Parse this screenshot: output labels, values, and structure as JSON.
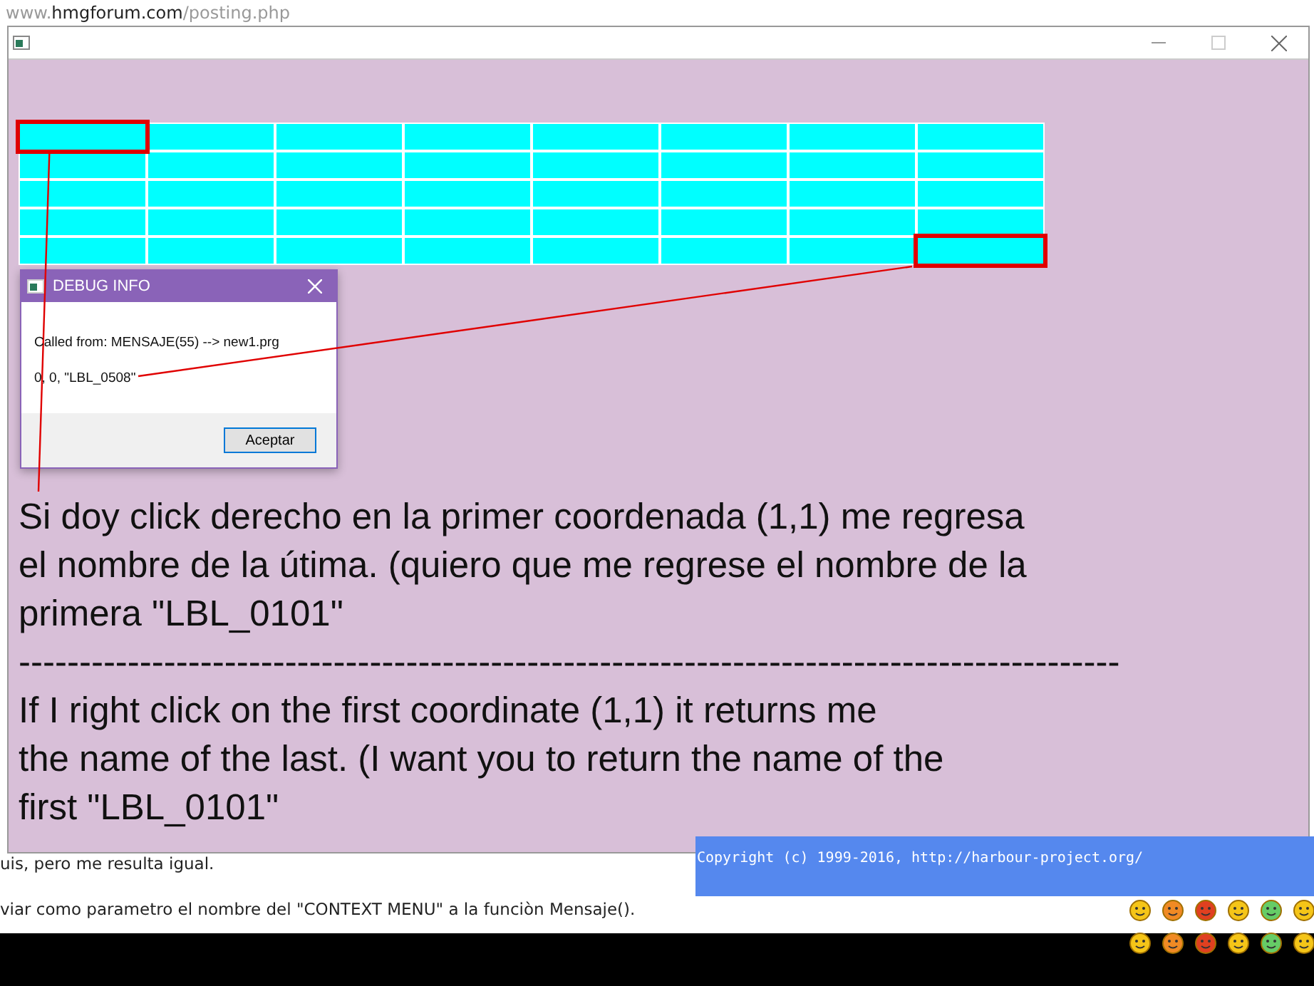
{
  "browser": {
    "url_prefix": "www.",
    "url_domain": "hmgforum.com",
    "url_path": "/posting.php"
  },
  "window": {
    "grid": {
      "rows": [
        {
          "cells": [
            {
              "highlighted": true
            },
            {
              "highlighted": false
            },
            {
              "highlighted": false
            },
            {
              "highlighted": false
            },
            {
              "highlighted": false
            },
            {
              "highlighted": false
            },
            {
              "highlighted": false
            },
            {
              "highlighted": false
            }
          ]
        },
        {
          "cells": [
            {
              "highlighted": false
            },
            {
              "highlighted": false
            },
            {
              "highlighted": false
            },
            {
              "highlighted": false
            },
            {
              "highlighted": false
            },
            {
              "highlighted": false
            },
            {
              "highlighted": false
            },
            {
              "highlighted": false
            }
          ]
        },
        {
          "cells": [
            {
              "highlighted": false
            },
            {
              "highlighted": false
            },
            {
              "highlighted": false
            },
            {
              "highlighted": false
            },
            {
              "highlighted": false
            },
            {
              "highlighted": false
            },
            {
              "highlighted": false
            },
            {
              "highlighted": false
            }
          ]
        },
        {
          "cells": [
            {
              "highlighted": false
            },
            {
              "highlighted": false
            },
            {
              "highlighted": false
            },
            {
              "highlighted": false
            },
            {
              "highlighted": false
            },
            {
              "highlighted": false
            },
            {
              "highlighted": false
            },
            {
              "highlighted": false
            }
          ]
        },
        {
          "cells": [
            {
              "highlighted": false
            },
            {
              "highlighted": false
            },
            {
              "highlighted": false
            },
            {
              "highlighted": false
            },
            {
              "highlighted": false
            },
            {
              "highlighted": false
            },
            {
              "highlighted": false
            },
            {
              "highlighted": true
            }
          ]
        }
      ]
    },
    "dialog": {
      "title": "DEBUG INFO",
      "lines": [
        "Called from: MENSAJE(55) --> new1.prg",
        "0, 0, \"LBL_0508\""
      ],
      "button": "Aceptar"
    },
    "note_es": [
      "Si doy click derecho en la primer coordenada (1,1) me regresa",
      "el nombre de la útima. (quiero que me regrese el nombre de la",
      "primera \"LBL_0101\""
    ],
    "separator": "-------------------------------------------------------------------------------------------",
    "note_en": [
      "If I right click on the first coordinate (1,1) it returns me",
      "the name of the last. (I want you to return the name of the",
      "first \"LBL_0101\""
    ]
  },
  "background_page": {
    "lines": [
      "uis, pero me resulta igual.",
      "viar como parametro el nombre del \"CONTEXT MENU\" a la funciòn Mensaje()."
    ],
    "console": "Copyright (c) 1999-2016, http://harbour-project.org/"
  }
}
